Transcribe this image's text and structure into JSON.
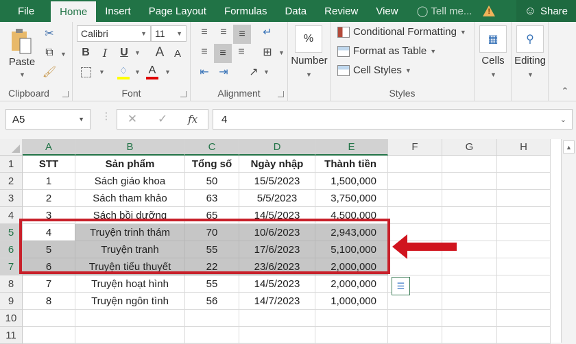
{
  "tabs": [
    "File",
    "Home",
    "Insert",
    "Page Layout",
    "Formulas",
    "Data",
    "Review",
    "View"
  ],
  "active_tab": "Home",
  "tell_me": "Tell me...",
  "share_label": "Share",
  "ribbon": {
    "clipboard": {
      "paste_label": "Paste",
      "group_label": "Clipboard"
    },
    "font": {
      "name": "Calibri",
      "size": "11",
      "bold": "B",
      "italic": "I",
      "underline": "U",
      "grow": "A",
      "shrink": "A",
      "group_label": "Font",
      "fill_color": "#ffff00",
      "font_color": "#e00000"
    },
    "alignment": {
      "group_label": "Alignment"
    },
    "number": {
      "symbol": "%",
      "label": "Number"
    },
    "styles": {
      "conditional": "Conditional Formatting",
      "format_table": "Format as Table",
      "cell_styles": "Cell Styles",
      "group_label": "Styles"
    },
    "cells": {
      "label": "Cells"
    },
    "editing": {
      "label": "Editing"
    }
  },
  "formula_bar": {
    "name_box": "A5",
    "cancel": "✕",
    "enter": "✓",
    "fx": "fx",
    "value": "4"
  },
  "columns": [
    "A",
    "B",
    "C",
    "D",
    "E",
    "F",
    "G",
    "H"
  ],
  "selected_columns": [
    "A",
    "B",
    "C",
    "D",
    "E"
  ],
  "rows": [
    "1",
    "2",
    "3",
    "4",
    "5",
    "6",
    "7",
    "8",
    "9",
    "10",
    "11"
  ],
  "selected_rows": [
    "5",
    "6",
    "7"
  ],
  "table": {
    "headers": [
      "STT",
      "Sản phẩm",
      "Tổng số",
      "Ngày nhập",
      "Thành tiền"
    ],
    "data": [
      [
        "1",
        "Sách giáo khoa",
        "50",
        "15/5/2023",
        "1,500,000"
      ],
      [
        "2",
        "Sách tham khảo",
        "63",
        "5/5/2023",
        "3,750,000"
      ],
      [
        "3",
        "Sách bồi dưỡng",
        "65",
        "14/5/2023",
        "4,500,000"
      ],
      [
        "4",
        "Truyện trinh thám",
        "70",
        "10/6/2023",
        "2,943,000"
      ],
      [
        "5",
        "Truyện tranh",
        "55",
        "17/6/2023",
        "5,100,000"
      ],
      [
        "6",
        "Truyện tiểu thuyết",
        "22",
        "23/6/2023",
        "2,000,000"
      ],
      [
        "7",
        "Truyện hoạt hình",
        "55",
        "14/5/2023",
        "2,000,000"
      ],
      [
        "8",
        "Truyện ngôn tình",
        "56",
        "14/7/2023",
        "1,000,000"
      ]
    ]
  },
  "colors": {
    "brand": "#217346",
    "highlight": "#c8202a",
    "selection": "#c6c6c6"
  }
}
